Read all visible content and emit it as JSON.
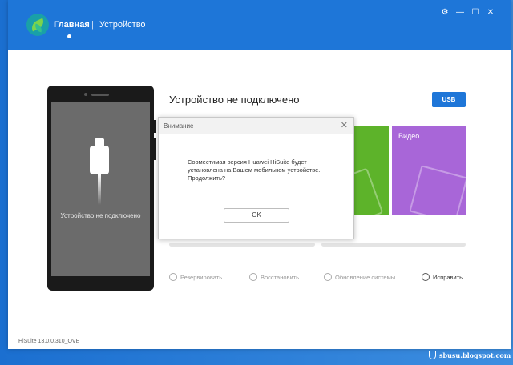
{
  "app": {
    "nav_home": "Главная",
    "nav_separator": "|",
    "nav_device": "Устройство",
    "window_controls": {
      "settings": "⚙",
      "minimize": "—",
      "maximize": "☐",
      "close": "✕"
    },
    "accent_color": "#1e76d8"
  },
  "phone": {
    "screen_text": "Устройство не подключено"
  },
  "main": {
    "status_title": "Устройство не подключено",
    "usb_button": "USB",
    "tiles": [
      {
        "label": "",
        "color": "#5db32a"
      },
      {
        "label": "Видео",
        "color": "#a866d8"
      }
    ],
    "actions": [
      {
        "label": "Резервировать",
        "icon": "backup-icon",
        "enabled": false
      },
      {
        "label": "Восстановить",
        "icon": "restore-icon",
        "enabled": false
      },
      {
        "label": "Обновление системы",
        "icon": "system-update-icon",
        "enabled": false
      },
      {
        "label": "Исправить",
        "icon": "repair-gear-icon",
        "enabled": true
      }
    ]
  },
  "footer": {
    "version": "HiSuite 13.0.0.310_OVE"
  },
  "dialog": {
    "title": "Внимание",
    "message": "Совместимая версия Huawei HiSuite будет установлена на Вашем мобильном устройстве. Продолжить?",
    "ok_button": "OK"
  },
  "watermark": {
    "text": "sbusu.blogspot.com"
  }
}
